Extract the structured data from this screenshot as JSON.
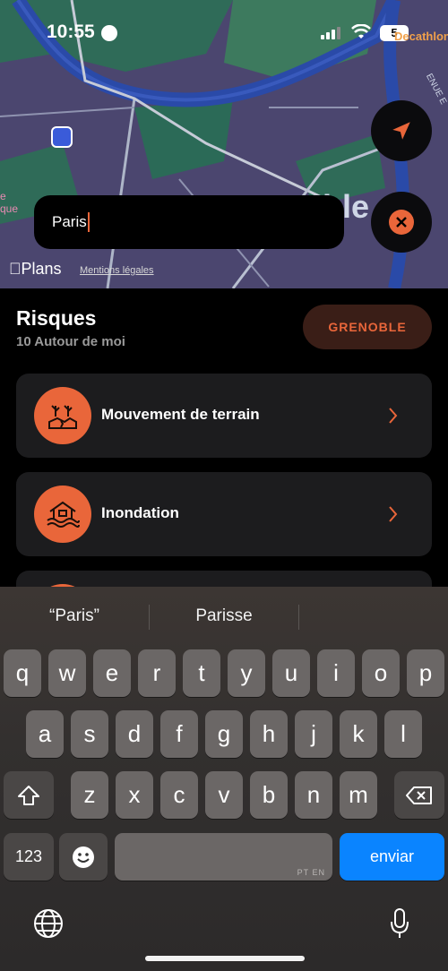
{
  "status_bar": {
    "time": "10:55",
    "battery": "5"
  },
  "map": {
    "label_decathlon": "Decathlon",
    "label_city": "ble",
    "label_left": "e\nque",
    "label_street": "ENUE E",
    "plans_logo": "Plans",
    "legal_link": "Mentions légales"
  },
  "search": {
    "value": "Paris"
  },
  "panel": {
    "title": "Risques",
    "subtitle": "10 Autour de moi",
    "city_chip": "GRENOBLE",
    "risks": [
      {
        "label": "Mouvement de terrain",
        "icon": "landslide-icon"
      },
      {
        "label": "Inondation",
        "icon": "flood-icon"
      }
    ]
  },
  "keyboard": {
    "suggestions": [
      "“Paris”",
      "Parisse",
      ""
    ],
    "row1": [
      "q",
      "w",
      "e",
      "r",
      "t",
      "y",
      "u",
      "i",
      "o",
      "p"
    ],
    "row2": [
      "a",
      "s",
      "d",
      "f",
      "g",
      "h",
      "j",
      "k",
      "l"
    ],
    "row3": [
      "z",
      "x",
      "c",
      "v",
      "b",
      "n",
      "m"
    ],
    "numbers_key": "123",
    "space_sub": "PT EN",
    "return_key": "enviar"
  },
  "colors": {
    "accent": "#e9663a",
    "chip_bg": "#3a1e17",
    "card_bg": "#1c1c1e",
    "enviar": "#0a84ff"
  }
}
